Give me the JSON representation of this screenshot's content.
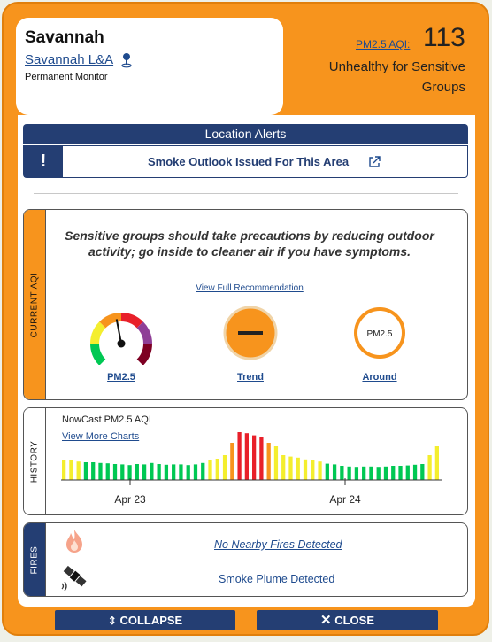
{
  "header": {
    "location": "Savannah",
    "site_name": "Savannah L&A",
    "monitor_type": "Permanent Monitor",
    "aqi_label": "PM2.5 AQI:",
    "aqi_value": "113",
    "aqi_category": "Unhealthy for Sensitive Groups"
  },
  "alerts": {
    "title": "Location Alerts",
    "items": [
      {
        "icon": "exclamation",
        "text": "Smoke Outlook Issued For This Area"
      }
    ]
  },
  "current_aqi": {
    "tab_label": "CURRENT AQI",
    "recommendation": "Sensitive groups should take precautions by reducing outdoor activity; go inside to cleaner air if you have symptoms.",
    "full_recommendation_link": "View Full Recommendation",
    "indicators": [
      {
        "name": "PM2.5",
        "icon": "gauge-icon",
        "gauge_level": 0.46
      },
      {
        "name": "Trend",
        "icon": "trend-flat-icon"
      },
      {
        "name": "Around",
        "icon": "pm25-ring-icon",
        "ring_text": "PM2.5"
      }
    ]
  },
  "history": {
    "tab_label": "HISTORY",
    "title": "NowCast PM2.5 AQI",
    "more_link": "View More Charts",
    "x_tick_labels": [
      "Apr 23",
      "Apr 24"
    ]
  },
  "fires": {
    "tab_label": "FIRES",
    "fire_text": "No Nearby Fires Detected",
    "plume_text": "Smoke Plume Detected"
  },
  "buttons": {
    "collapse": "COLLAPSE",
    "close": "CLOSE"
  },
  "colors": {
    "panel_orange": "#f7941d",
    "navy": "#243e73",
    "link_blue": "#1f4b8e",
    "aqi_green": "#00c853",
    "aqi_yellow": "#f4ee2e",
    "aqi_orange": "#f7941d",
    "aqi_red": "#e8202a"
  },
  "chart_data": {
    "type": "bar",
    "title": "NowCast PM2.5 AQI",
    "xlabel": "",
    "ylabel": "",
    "x_tick_labels": [
      "Apr 23",
      "Apr 24"
    ],
    "ylim": [
      0,
      140
    ],
    "values": [
      55,
      55,
      52,
      50,
      50,
      48,
      47,
      45,
      44,
      42,
      45,
      44,
      48,
      45,
      43,
      44,
      44,
      42,
      44,
      48,
      55,
      60,
      70,
      105,
      135,
      132,
      126,
      122,
      105,
      95,
      70,
      66,
      63,
      58,
      55,
      52,
      46,
      44,
      40,
      38,
      37,
      38,
      38,
      37,
      38,
      40,
      40,
      41,
      43,
      45,
      70,
      95
    ]
  }
}
